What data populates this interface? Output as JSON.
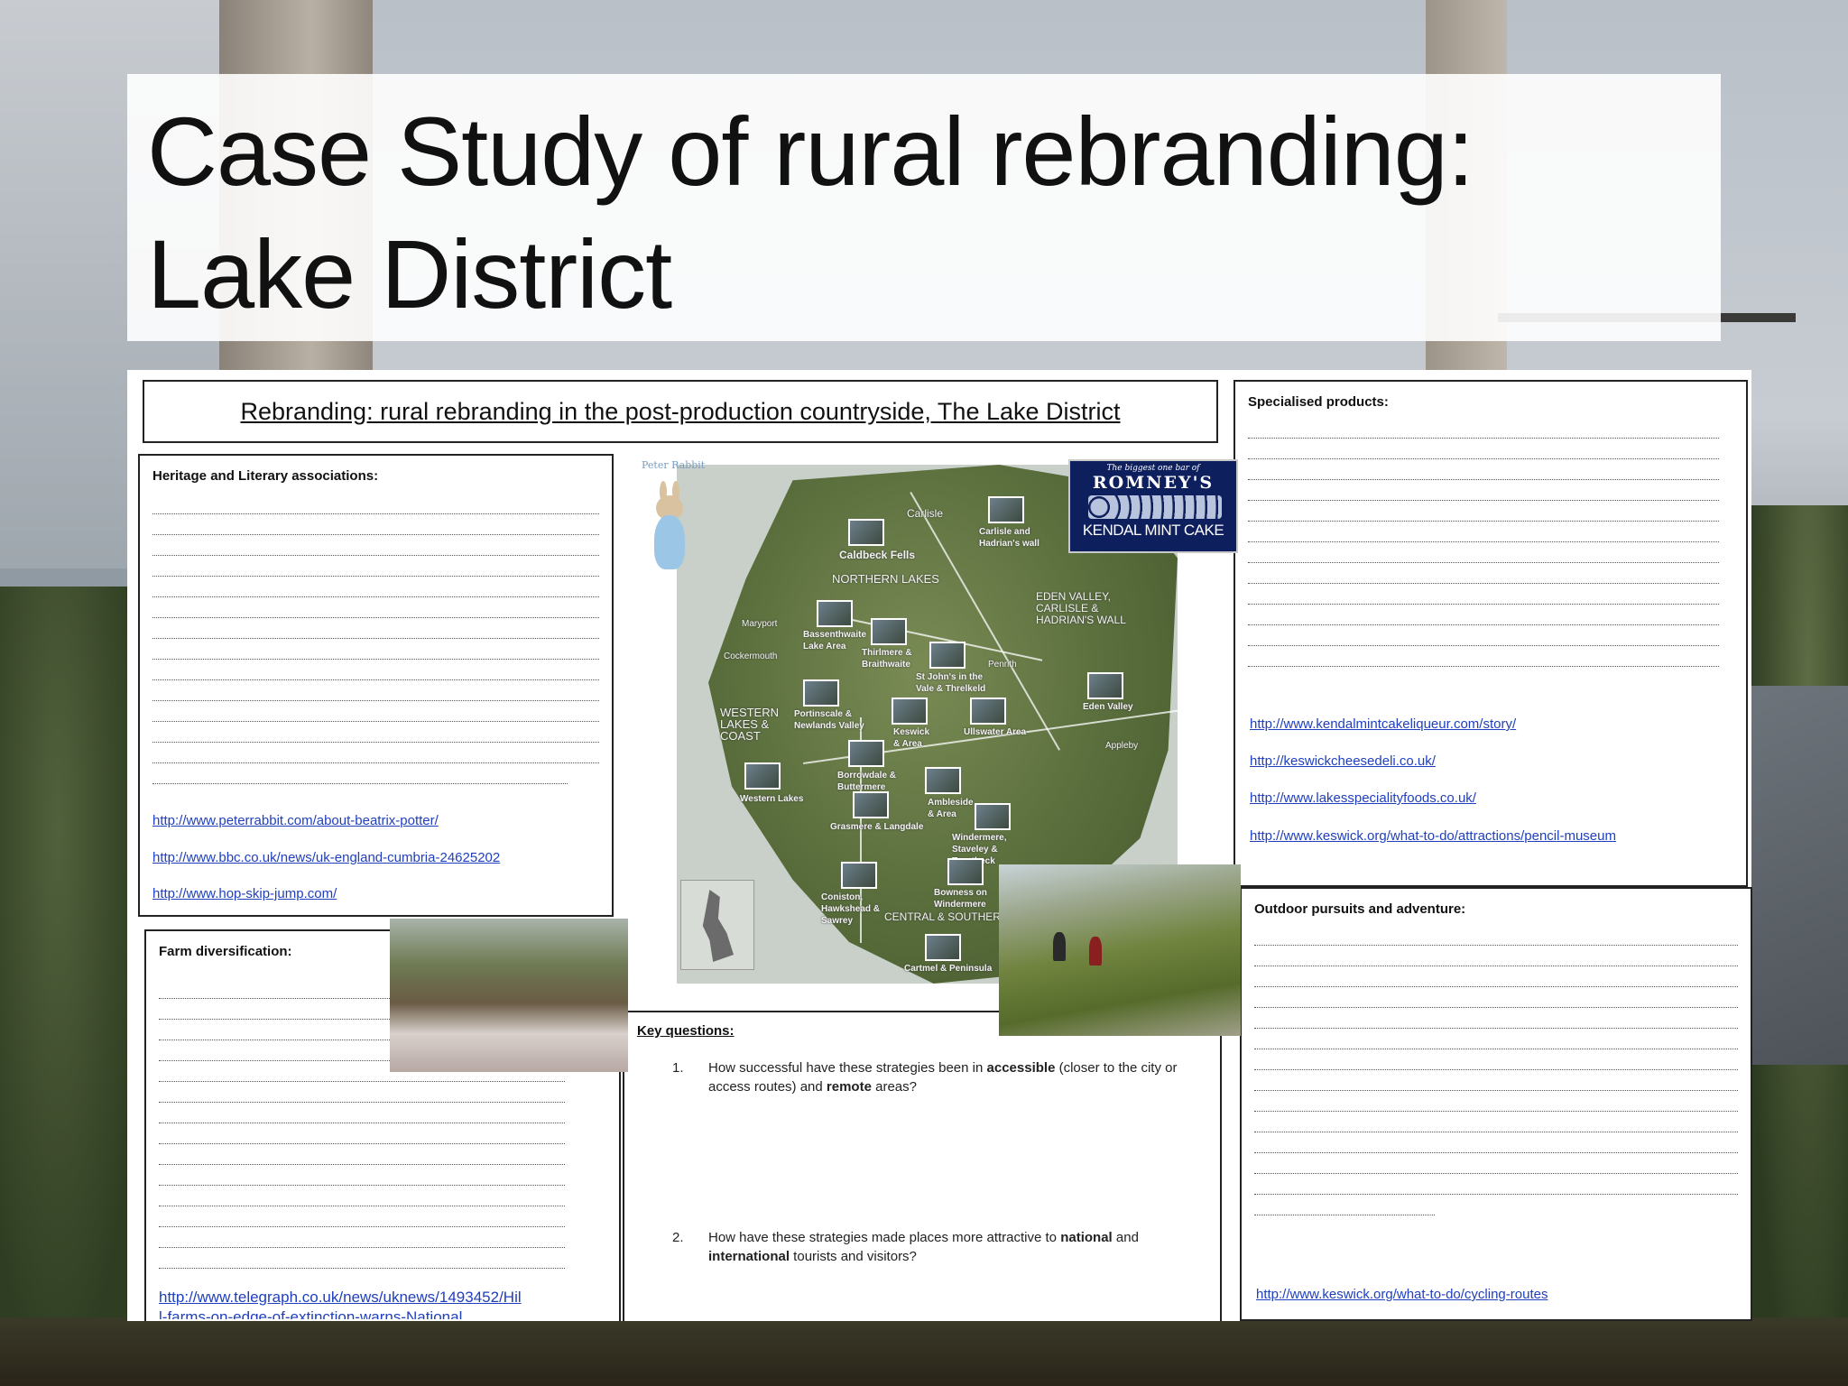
{
  "slide": {
    "title_line1": "Case Study of rural rebranding:",
    "title_line2": "Lake District"
  },
  "worksheet": {
    "heading": "Rebranding: rural rebranding in the post-production countryside, The Lake District",
    "heritage": {
      "heading": "Heritage and Literary associations:",
      "links": [
        "http://www.peterrabbit.com/about-beatrix-potter/",
        "http://www.bbc.co.uk/news/uk-england-cumbria-24625202",
        "http://www.hop-skip-jump.com/"
      ]
    },
    "farm": {
      "heading": "Farm diversification:",
      "links": [
        "http://www.telegraph.co.uk/news/uknews/1493452/Hil",
        "l-farms-on-edge-of-extinction-warns-National"
      ]
    },
    "specialised": {
      "heading": "Specialised products:",
      "links": [
        "http://www.kendalmintcakeliqueur.com/story/",
        "http://keswickcheesedeli.co.uk/",
        "http://www.lakesspecialityfoods.co.uk/",
        "http://www.keswick.org/what-to-do/attractions/pencil-museum"
      ]
    },
    "outdoor": {
      "heading": "Outdoor pursuits and adventure:",
      "links": [
        "http://www.keswick.org/what-to-do/cycling-routes"
      ]
    },
    "key_questions": {
      "heading": "Key questions:",
      "q1_num": "1.",
      "q1_a": "How successful have these strategies been in ",
      "q1_b": "accessible",
      "q1_c": " (closer to the city or access routes) and ",
      "q1_d": "remote",
      "q1_e": " areas?",
      "q2_num": "2.",
      "q2_a": "How have these strategies made places more attractive to ",
      "q2_b": "national",
      "q2_c": " and ",
      "q2_d": "international",
      "q2_e": " tourists and visitors?"
    },
    "rabbit_caption": "Peter Rabbit",
    "kendal_label": {
      "top": "The biggest one bar of",
      "brand": "ROMNEY'S",
      "product": "KENDAL MINT CAKE"
    },
    "map_labels": {
      "carlisle": "Carlisle",
      "northern_lakes": "NORTHERN LAKES",
      "eden": "EDEN VALLEY, CARLISLE & HADRIAN'S WALL",
      "western": "WESTERN LAKES & COAST",
      "central": "CENTRAL & SOUTHERN",
      "caldbeck": "Caldbeck Fells",
      "carlisle_wall": "Carlisle and Hadrian's wall",
      "bassenthwaite": "Bassenthwaite Lake Area",
      "thirlmere": "Thirlmere & Braithwaite",
      "stjohns": "St John's in the Vale & Threlkeld",
      "eden_valley": "Eden Valley",
      "portinscale": "Portinscale & Newlands Valley",
      "keswick": "Keswick & Area",
      "ullswater": "Ullswater Area",
      "borrowdale": "Borrowdale & Buttermere",
      "western_lakes": "Western Lakes",
      "ambleside": "Ambleside & Area",
      "grasmere": "Grasmere & Langdale",
      "windermere": "Windermere, Staveley & Troutbeck",
      "coniston": "Coniston, Hawkshead & Sawrey",
      "bowness": "Bowness on Windermere",
      "cartmel": "Cartmel & Peninsula",
      "maryport": "Maryport",
      "cockermouth": "Cockermouth",
      "penrith": "Penrith",
      "appleby": "Appleby"
    }
  }
}
